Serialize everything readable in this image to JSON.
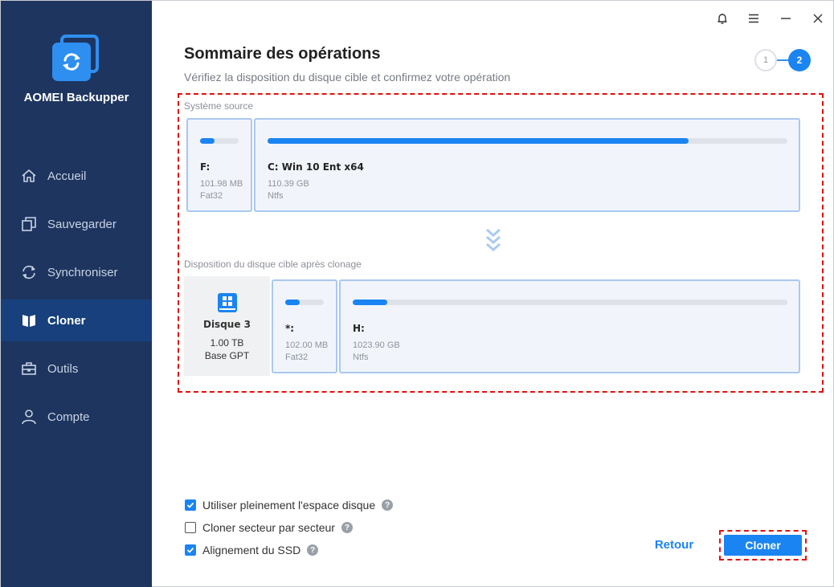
{
  "app": {
    "name": "AOMEI Backupper"
  },
  "nav": {
    "items": [
      {
        "label": "Accueil",
        "icon": "home-icon"
      },
      {
        "label": "Sauvegarder",
        "icon": "backup-icon"
      },
      {
        "label": "Synchroniser",
        "icon": "sync-icon"
      },
      {
        "label": "Cloner",
        "icon": "clone-icon",
        "active": true
      },
      {
        "label": "Outils",
        "icon": "tools-icon"
      },
      {
        "label": "Compte",
        "icon": "user-icon"
      }
    ]
  },
  "header": {
    "title": "Sommaire des opérations",
    "subtitle": "Vérifiez la disposition du disque cible et confirmez votre opération",
    "steps": [
      "1",
      "2"
    ],
    "current_step": 2
  },
  "source": {
    "label": "Système source",
    "partitions": [
      {
        "name": "F:",
        "size": "101.98 MB",
        "fs": "Fat32",
        "used_fraction": 0.38
      },
      {
        "name": "C: Win 10 Ent x64",
        "size": "110.39 GB",
        "fs": "Ntfs",
        "used_fraction": 0.81
      }
    ]
  },
  "target": {
    "label": "Disposition du disque cible après clonage",
    "disk": {
      "name": "Disque 3",
      "size": "1.00 TB",
      "type": "Base GPT"
    },
    "partitions": [
      {
        "name": "*:",
        "size": "102.00 MB",
        "fs": "Fat32",
        "used_fraction": 0.38
      },
      {
        "name": "H:",
        "size": "1023.90 GB",
        "fs": "Ntfs",
        "used_fraction": 0.08
      }
    ]
  },
  "options": [
    {
      "label": "Utiliser pleinement l'espace disque",
      "checked": true
    },
    {
      "label": "Cloner secteur par secteur",
      "checked": false
    },
    {
      "label": "Alignement du SSD",
      "checked": true
    }
  ],
  "buttons": {
    "back": "Retour",
    "clone": "Cloner"
  },
  "colors": {
    "sidebar": "#1e3560",
    "accent": "#1a84f2",
    "highlight": "#e00f0f"
  }
}
